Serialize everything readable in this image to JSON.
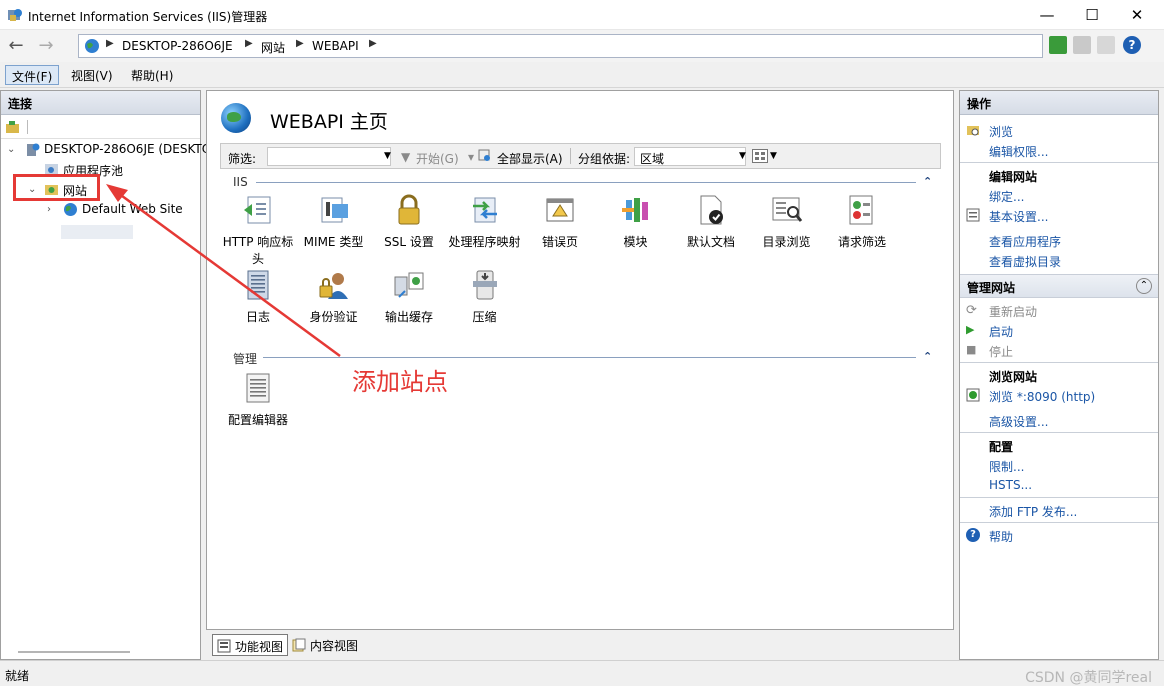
{
  "window": {
    "title": "Internet Information Services (IIS)管理器",
    "controls": {
      "minimize": "—",
      "maximize": "☐",
      "close": "✕"
    }
  },
  "address": {
    "crumbs": [
      "DESKTOP-286O6JE",
      "网站",
      "WEBAPI"
    ]
  },
  "menu": {
    "items": [
      "文件(F)",
      "视图(V)",
      "帮助(H)"
    ]
  },
  "connections": {
    "title": "连接",
    "tree": {
      "server": "DESKTOP-286O6JE (DESKTOP-286O6JE\\",
      "app_pools": "应用程序池",
      "sites": "网站",
      "default_site": "Default Web Site"
    }
  },
  "main": {
    "title": "WEBAPI 主页",
    "filter_label": "筛选:",
    "start_button": "开始(G)",
    "show_all_button": "全部显示(A)",
    "group_by_label": "分组依据:",
    "group_by_value": "区域",
    "section_iis": "IIS",
    "section_management": "管理",
    "features_iis": [
      {
        "label": "HTTP 响应标头",
        "icon": "http-headers-icon"
      },
      {
        "label": "MIME 类型",
        "icon": "mime-types-icon"
      },
      {
        "label": "SSL 设置",
        "icon": "ssl-lock-icon"
      },
      {
        "label": "处理程序映射",
        "icon": "handler-mappings-icon"
      },
      {
        "label": "错误页",
        "icon": "error-pages-icon"
      },
      {
        "label": "模块",
        "icon": "modules-icon"
      },
      {
        "label": "默认文档",
        "icon": "default-document-icon"
      },
      {
        "label": "目录浏览",
        "icon": "directory-browsing-icon"
      },
      {
        "label": "请求筛选",
        "icon": "request-filtering-icon"
      },
      {
        "label": "日志",
        "icon": "logging-icon"
      },
      {
        "label": "身份验证",
        "icon": "authentication-icon"
      },
      {
        "label": "输出缓存",
        "icon": "output-caching-icon"
      },
      {
        "label": "压缩",
        "icon": "compression-icon"
      }
    ],
    "features_management": [
      {
        "label": "配置编辑器",
        "icon": "configuration-editor-icon"
      }
    ],
    "tab_features": "功能视图",
    "tab_content": "内容视图"
  },
  "annotation": {
    "text": "添加站点",
    "color": "#e53935"
  },
  "actions": {
    "title": "操作",
    "browse": "浏览",
    "edit_permissions": "编辑权限...",
    "edit_site_heading": "编辑网站",
    "bindings": "绑定...",
    "basic_settings": "基本设置...",
    "view_applications": "查看应用程序",
    "view_virtual_dirs": "查看虚拟目录",
    "manage_site": "管理网站",
    "restart": "重新启动",
    "start": "启动",
    "stop": "停止",
    "browse_site_heading": "浏览网站",
    "browse_port": "浏览 *:8090 (http)",
    "advanced_settings": "高级设置...",
    "config_heading": "配置",
    "limits": "限制...",
    "hsts": "HSTS...",
    "add_ftp": "添加 FTP 发布...",
    "help": "帮助"
  },
  "status": {
    "text": "就绪",
    "watermark": "CSDN @黄同学real"
  }
}
